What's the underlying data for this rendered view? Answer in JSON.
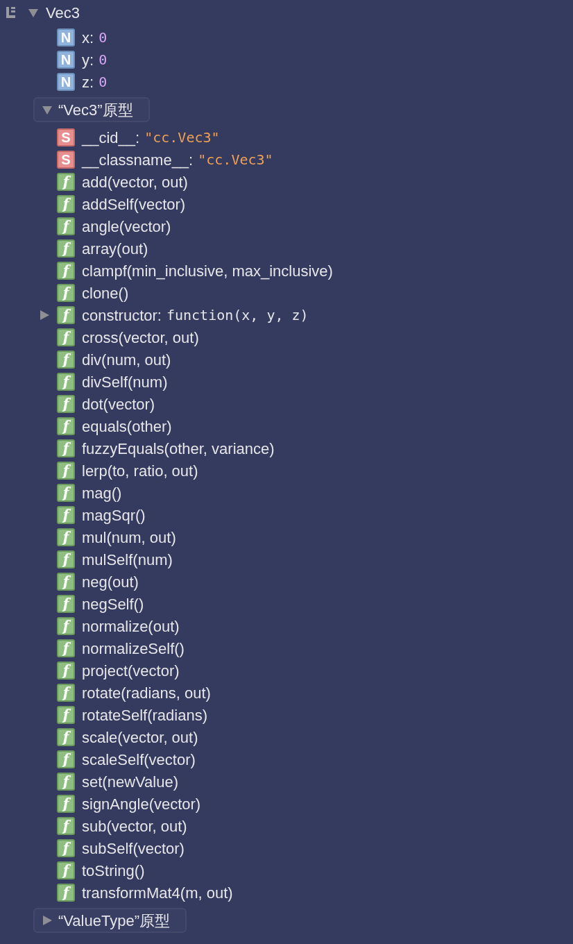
{
  "root": {
    "label": "Vec3",
    "expanded": true,
    "children": [
      {
        "kind": "number",
        "badge": "N",
        "name": "x:",
        "value": "0"
      },
      {
        "kind": "number",
        "badge": "N",
        "name": "y:",
        "value": "0"
      },
      {
        "kind": "number",
        "badge": "N",
        "name": "z:",
        "value": "0"
      },
      {
        "kind": "group",
        "label": "“Vec3”原型",
        "expanded": true,
        "children": [
          {
            "kind": "string",
            "badge": "S",
            "name": "__cid__:",
            "value": "\"cc.Vec3\""
          },
          {
            "kind": "string",
            "badge": "S",
            "name": "__classname__:",
            "value": "\"cc.Vec3\""
          },
          {
            "kind": "method",
            "badge": "f",
            "label": "add(vector, out)"
          },
          {
            "kind": "method",
            "badge": "f",
            "label": "addSelf(vector)"
          },
          {
            "kind": "method",
            "badge": "f",
            "label": "angle(vector)"
          },
          {
            "kind": "method",
            "badge": "f",
            "label": "array(out)"
          },
          {
            "kind": "method",
            "badge": "f",
            "label": "clampf(min_inclusive, max_inclusive)"
          },
          {
            "kind": "method",
            "badge": "f",
            "label": "clone()"
          },
          {
            "kind": "function",
            "badge": "f",
            "name": "constructor:",
            "value": "function(x, y, z)",
            "expanded": false
          },
          {
            "kind": "method",
            "badge": "f",
            "label": "cross(vector, out)"
          },
          {
            "kind": "method",
            "badge": "f",
            "label": "div(num, out)"
          },
          {
            "kind": "method",
            "badge": "f",
            "label": "divSelf(num)"
          },
          {
            "kind": "method",
            "badge": "f",
            "label": "dot(vector)"
          },
          {
            "kind": "method",
            "badge": "f",
            "label": "equals(other)"
          },
          {
            "kind": "method",
            "badge": "f",
            "label": "fuzzyEquals(other, variance)"
          },
          {
            "kind": "method",
            "badge": "f",
            "label": "lerp(to, ratio, out)"
          },
          {
            "kind": "method",
            "badge": "f",
            "label": "mag()"
          },
          {
            "kind": "method",
            "badge": "f",
            "label": "magSqr()"
          },
          {
            "kind": "method",
            "badge": "f",
            "label": "mul(num, out)"
          },
          {
            "kind": "method",
            "badge": "f",
            "label": "mulSelf(num)"
          },
          {
            "kind": "method",
            "badge": "f",
            "label": "neg(out)"
          },
          {
            "kind": "method",
            "badge": "f",
            "label": "negSelf()"
          },
          {
            "kind": "method",
            "badge": "f",
            "label": "normalize(out)"
          },
          {
            "kind": "method",
            "badge": "f",
            "label": "normalizeSelf()"
          },
          {
            "kind": "method",
            "badge": "f",
            "label": "project(vector)"
          },
          {
            "kind": "method",
            "badge": "f",
            "label": "rotate(radians, out)"
          },
          {
            "kind": "method",
            "badge": "f",
            "label": "rotateSelf(radians)"
          },
          {
            "kind": "method",
            "badge": "f",
            "label": "scale(vector, out)"
          },
          {
            "kind": "method",
            "badge": "f",
            "label": "scaleSelf(vector)"
          },
          {
            "kind": "method",
            "badge": "f",
            "label": "set(newValue)"
          },
          {
            "kind": "method",
            "badge": "f",
            "label": "signAngle(vector)"
          },
          {
            "kind": "method",
            "badge": "f",
            "label": "sub(vector, out)"
          },
          {
            "kind": "method",
            "badge": "f",
            "label": "subSelf(vector)"
          },
          {
            "kind": "method",
            "badge": "f",
            "label": "toString()"
          },
          {
            "kind": "method",
            "badge": "f",
            "label": "transformMat4(m, out)"
          }
        ]
      },
      {
        "kind": "group",
        "label": "“ValueType”原型",
        "expanded": false
      }
    ]
  }
}
